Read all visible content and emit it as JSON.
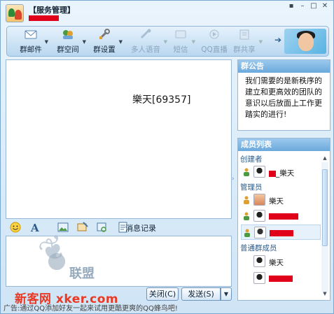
{
  "window": {
    "title": "【服务管理】",
    "controls": [
      "pin-icon",
      "minimize-icon",
      "maximize-icon",
      "close-icon"
    ]
  },
  "toolbar": {
    "items": [
      {
        "label": "群邮件",
        "icon": "mail-icon",
        "enabled": true
      },
      {
        "label": "群空间",
        "icon": "group-space-icon",
        "enabled": true
      },
      {
        "label": "群设置",
        "icon": "settings-icon",
        "enabled": true
      },
      {
        "label": "多人语音",
        "icon": "voice-icon",
        "enabled": false
      },
      {
        "label": "短信",
        "icon": "sms-icon",
        "enabled": false
      },
      {
        "label": "QQ直播",
        "icon": "live-icon",
        "enabled": false
      },
      {
        "label": "群共享",
        "icon": "share-icon",
        "enabled": false
      }
    ]
  },
  "chat": {
    "remote_name": "樂天[69357]"
  },
  "input_toolbar": {
    "history_label": "消息记录"
  },
  "watermark": {
    "brand": "联盟",
    "site": "新客网 xker.com"
  },
  "buttons": {
    "close_label": "关闭(C)",
    "send_label": "发送(S)"
  },
  "ad_text": "广告:通过QQ添加好友一起来试用更酷更爽的QQ蜂鸟吧!",
  "announcement": {
    "title": "群公告",
    "text": "我们需要的是新秩序的建立和更高效的团队的意识以后放面上工作更踏实的进行!"
  },
  "members": {
    "title": "成员列表",
    "groups": [
      {
        "label": "创建者"
      },
      {
        "label": "管理员"
      },
      {
        "label": "普通群成员"
      }
    ],
    "list": [
      {
        "name": "_樂天"
      },
      {
        "name": "樂天"
      },
      {
        "name": ""
      },
      {
        "name": ""
      },
      {
        "name": "樂天"
      },
      {
        "name": ""
      }
    ]
  },
  "colors": {
    "accent": "#6ba9dc",
    "redact": "#e0001a",
    "watermark_site": "#e83a24"
  }
}
